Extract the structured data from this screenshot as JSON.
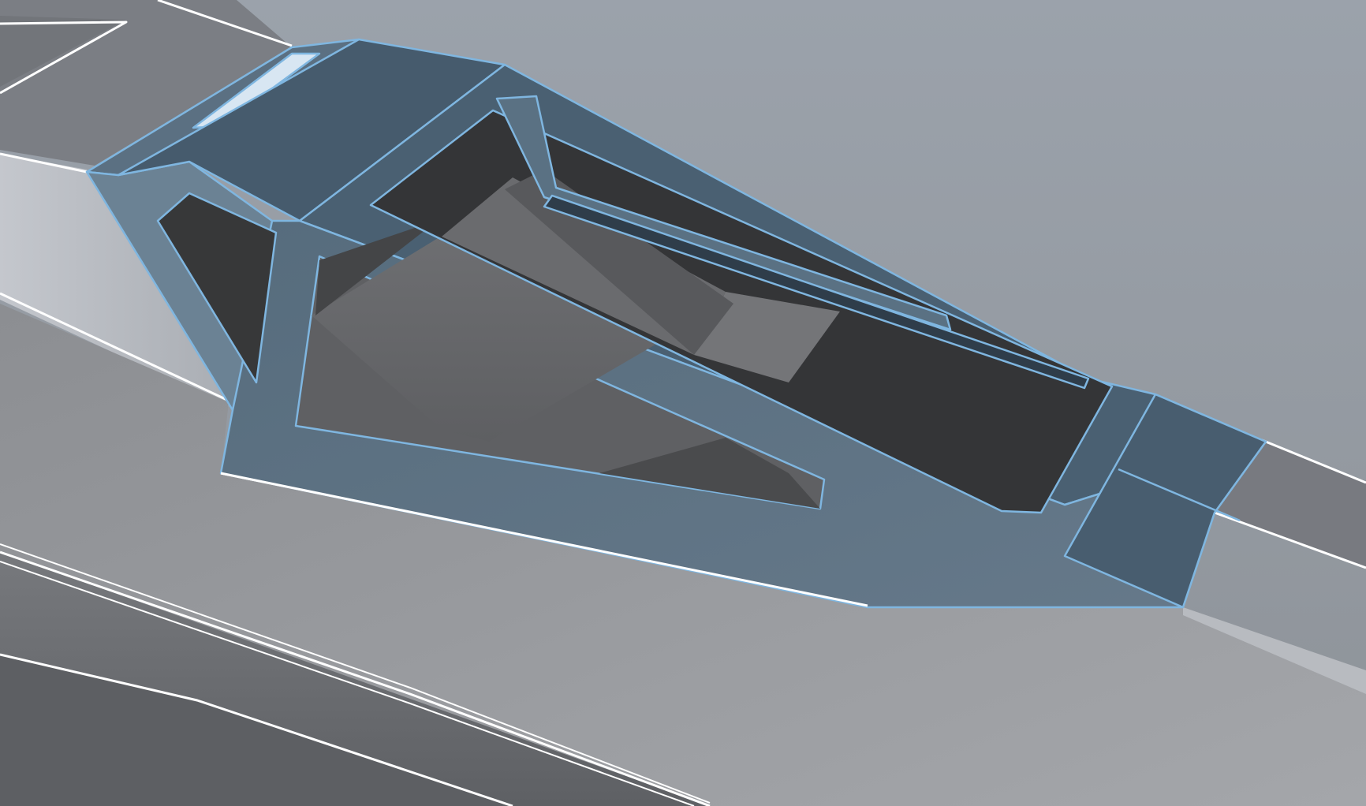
{
  "viewport": {
    "type": "3d-model-viewport",
    "selection_highlight_color": "#7fb6e0",
    "selected_object": "canopy-frame",
    "colors": {
      "background": "#9aa1a9",
      "frame_top": "#465b6d",
      "frame_side": "#5a7284",
      "interior_dark": "#363739",
      "interior_mid": "#6a6b6e",
      "edge_highlight": "#ffffff"
    }
  }
}
